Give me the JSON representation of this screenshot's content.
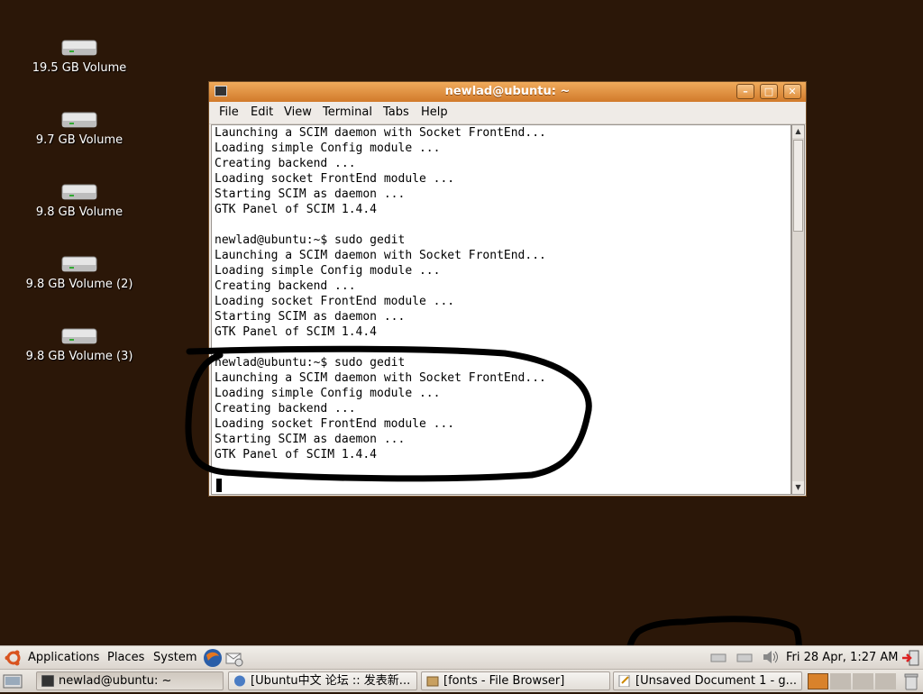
{
  "desktop": {
    "icons": [
      {
        "label": "19.5 GB Volume"
      },
      {
        "label": "9.7 GB Volume"
      },
      {
        "label": "9.8 GB Volume"
      },
      {
        "label": "9.8 GB Volume (2)"
      },
      {
        "label": "9.8 GB Volume (3)"
      }
    ]
  },
  "window": {
    "title": "newlad@ubuntu: ~",
    "menu": [
      "File",
      "Edit",
      "View",
      "Terminal",
      "Tabs",
      "Help"
    ],
    "terminal_lines": [
      "Launching a SCIM daemon with Socket FrontEnd...",
      "Loading simple Config module ...",
      "Creating backend ...",
      "Loading socket FrontEnd module ...",
      "Starting SCIM as daemon ...",
      "GTK Panel of SCIM 1.4.4",
      "",
      "newlad@ubuntu:~$ sudo gedit",
      "Launching a SCIM daemon with Socket FrontEnd...",
      "Loading simple Config module ...",
      "Creating backend ...",
      "Loading socket FrontEnd module ...",
      "Starting SCIM as daemon ...",
      "GTK Panel of SCIM 1.4.4",
      "",
      "newlad@ubuntu:~$ sudo gedit",
      "Launching a SCIM daemon with Socket FrontEnd...",
      "Loading simple Config module ...",
      "Creating backend ...",
      "Loading socket FrontEnd module ...",
      "Starting SCIM as daemon ...",
      "GTK Panel of SCIM 1.4.4"
    ]
  },
  "top_panel": {
    "menus": [
      "Applications",
      "Places",
      "System"
    ],
    "clock": "Fri 28 Apr,  1:27 AM"
  },
  "taskbar": {
    "tasks": [
      {
        "label": "newlad@ubuntu: ~",
        "icon": "terminal-icon"
      },
      {
        "label": "[Ubuntu中文 论坛 :: 发表新...",
        "icon": "globe-icon"
      },
      {
        "label": "[fonts - File Browser]",
        "icon": "folder-icon"
      },
      {
        "label": "[Unsaved Document 1 - g...",
        "icon": "text-editor-icon"
      }
    ]
  },
  "colors": {
    "desktop": "#2b1708",
    "titlebar": "#e08f3c",
    "annotation": "#000000"
  }
}
